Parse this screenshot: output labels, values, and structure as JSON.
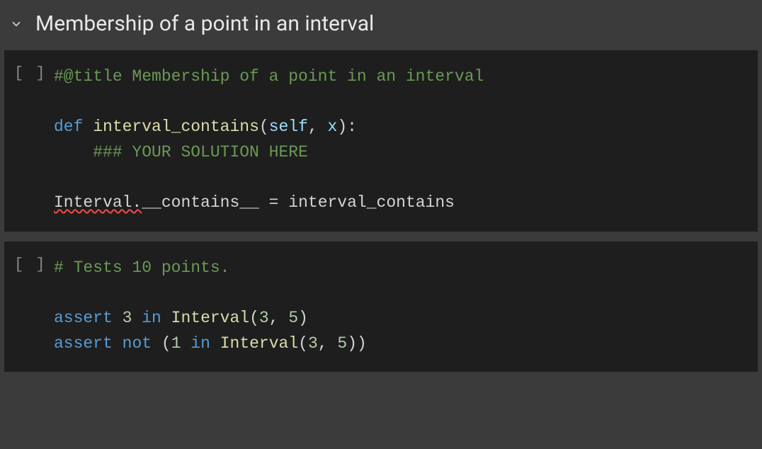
{
  "section": {
    "title": "Membership of a point in an interval"
  },
  "cells": [
    {
      "gutter": "[ ]",
      "lines": {
        "l0_comment": "#@title Membership of a point in an interval",
        "l1_blank": "",
        "l2_def": "def",
        "l2_fn": "interval_contains",
        "l2_open": "(",
        "l2_self": "self",
        "l2_comma": ", ",
        "l2_x": "x",
        "l2_close": ")",
        "l2_colon": ":",
        "l3_indent": "    ",
        "l3_comment": "### YOUR SOLUTION HERE",
        "l4_blank": "",
        "l5_interval": "Interval",
        "l5_dot": ".",
        "l5_dunder": "__contains__",
        "l5_eq": " = ",
        "l5_rhs": "interval_contains"
      }
    },
    {
      "gutter": "[ ]",
      "lines": {
        "l0_comment": "# Tests 10 points.",
        "l1_blank": "",
        "l2_assert": "assert",
        "l2_sp": " ",
        "l2_num1": "3",
        "l2_in": " in ",
        "l2_class": "Interval",
        "l2_open": "(",
        "l2_a": "3",
        "l2_comma": ", ",
        "l2_b": "5",
        "l2_close": ")",
        "l3_assert": "assert",
        "l3_sp": " ",
        "l3_not": "not",
        "l3_sp2": " ",
        "l3_open": "(",
        "l3_num1": "1",
        "l3_in": " in ",
        "l3_class": "Interval",
        "l3_open2": "(",
        "l3_a": "3",
        "l3_comma": ", ",
        "l3_b": "5",
        "l3_close2": ")",
        "l3_close": ")"
      }
    }
  ]
}
